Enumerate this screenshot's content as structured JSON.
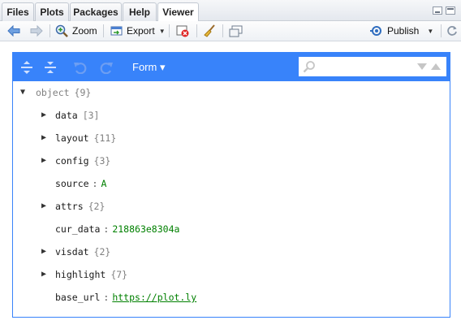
{
  "tabs": [
    "Files",
    "Plots",
    "Packages",
    "Help",
    "Viewer"
  ],
  "active_tab": "Viewer",
  "toolbar": {
    "zoom_label": "Zoom",
    "export_label": "Export",
    "publish_label": "Publish"
  },
  "editor": {
    "mode_label": "Form ▾",
    "search_placeholder": ""
  },
  "tree": {
    "root_key": "object",
    "root_count": "{9}",
    "items": [
      {
        "key": "data",
        "count": "[3]",
        "expandable": true
      },
      {
        "key": "layout",
        "count": "{11}",
        "expandable": true
      },
      {
        "key": "config",
        "count": "{3}",
        "expandable": true
      },
      {
        "key": "source",
        "value": "A",
        "expandable": false
      },
      {
        "key": "attrs",
        "count": "{2}",
        "expandable": true
      },
      {
        "key": "cur_data",
        "value": "218863e8304a",
        "expandable": false
      },
      {
        "key": "visdat",
        "count": "{2}",
        "expandable": true
      },
      {
        "key": "highlight",
        "count": "{7}",
        "expandable": true
      },
      {
        "key": "base_url",
        "value": "https://plot.ly",
        "expandable": false
      }
    ]
  },
  "colors": {
    "editor_accent": "#3883fa",
    "string_value": "#008000",
    "count_text": "#808080"
  }
}
